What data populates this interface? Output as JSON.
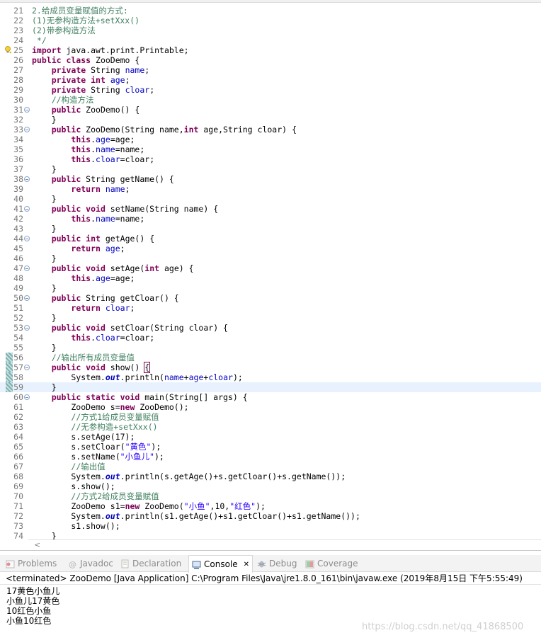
{
  "editor": {
    "lines": [
      {
        "n": "21",
        "html": "<span class=\"c\">2.给成员变量赋值的方式:</span>"
      },
      {
        "n": "22",
        "html": "<span class=\"c\">(1)无参构造方法+setXxx()</span>"
      },
      {
        "n": "23",
        "html": "<span class=\"c\">(2)带参构造方法</span>"
      },
      {
        "n": "24",
        "html": "<span class=\"c\"> */</span>"
      },
      {
        "n": "25",
        "html": "<span class=\"k\">import</span> java.awt.print.Printable;",
        "warn": true
      },
      {
        "n": "26",
        "html": "<span class=\"k\">public class</span> ZooDemo {"
      },
      {
        "n": "27",
        "html": "    <span class=\"k\">private</span> String <span class=\"f\">name</span>;"
      },
      {
        "n": "28",
        "html": "    <span class=\"k\">private int</span> <span class=\"f\">age</span>;"
      },
      {
        "n": "29",
        "html": "    <span class=\"k\">private</span> String <span class=\"f\">cloar</span>;"
      },
      {
        "n": "30",
        "html": "    <span class=\"c\">//构造方法</span>"
      },
      {
        "n": "31",
        "fold": true,
        "html": "    <span class=\"k\">public</span> ZooDemo() {"
      },
      {
        "n": "32",
        "html": "    }"
      },
      {
        "n": "33",
        "fold": true,
        "html": "    <span class=\"k\">public</span> ZooDemo(String name,<span class=\"k\">int</span> age,String cloar) {"
      },
      {
        "n": "34",
        "html": "        <span class=\"k\">this</span>.<span class=\"f\">age</span>=age;"
      },
      {
        "n": "35",
        "html": "        <span class=\"k\">this</span>.<span class=\"f\">name</span>=name;"
      },
      {
        "n": "36",
        "html": "        <span class=\"k\">this</span>.<span class=\"f\">cloar</span>=cloar;"
      },
      {
        "n": "37",
        "html": "    }"
      },
      {
        "n": "38",
        "fold": true,
        "html": "    <span class=\"k\">public</span> String getName() {"
      },
      {
        "n": "39",
        "html": "        <span class=\"k\">return</span> <span class=\"f\">name</span>;"
      },
      {
        "n": "40",
        "html": "    }"
      },
      {
        "n": "41",
        "fold": true,
        "html": "    <span class=\"k\">public void</span> setName(String name) {"
      },
      {
        "n": "42",
        "html": "        <span class=\"k\">this</span>.<span class=\"f\">name</span>=name;"
      },
      {
        "n": "43",
        "html": "    }"
      },
      {
        "n": "44",
        "fold": true,
        "html": "    <span class=\"k\">public int</span> getAge() {"
      },
      {
        "n": "45",
        "html": "        <span class=\"k\">return</span> <span class=\"f\">age</span>;"
      },
      {
        "n": "46",
        "html": "    }"
      },
      {
        "n": "47",
        "fold": true,
        "html": "    <span class=\"k\">public void</span> setAge(<span class=\"k\">int</span> age) {"
      },
      {
        "n": "48",
        "html": "        <span class=\"k\">this</span>.<span class=\"f\">age</span>=age;"
      },
      {
        "n": "49",
        "html": "    }"
      },
      {
        "n": "50",
        "fold": true,
        "html": "    <span class=\"k\">public</span> String getCloar() {"
      },
      {
        "n": "51",
        "html": "        <span class=\"k\">return</span> <span class=\"f\">cloar</span>;"
      },
      {
        "n": "52",
        "html": "    }"
      },
      {
        "n": "53",
        "fold": true,
        "html": "    <span class=\"k\">public void</span> setCloar(String cloar) {"
      },
      {
        "n": "54",
        "html": "        <span class=\"k\">this</span>.<span class=\"f\">cloar</span>=cloar;"
      },
      {
        "n": "55",
        "html": "    }"
      },
      {
        "n": "56",
        "chg": true,
        "html": "    <span class=\"c\">//输出所有成员变量值</span>"
      },
      {
        "n": "57",
        "chg": true,
        "fold": true,
        "html": "    <span class=\"k\">public void</span> show() <span class=\"box\">{</span>"
      },
      {
        "n": "58",
        "chg": true,
        "html": "        System.<span class=\"st\">out</span>.println(<span class=\"f\">name</span>+<span class=\"f\">age</span>+<span class=\"f\">cloar</span>);"
      },
      {
        "n": "59",
        "chg": true,
        "cur": true,
        "html": "    }"
      },
      {
        "n": "60",
        "fold": true,
        "html": "    <span class=\"k\">public static void</span> main(String[] args) {"
      },
      {
        "n": "61",
        "html": "        ZooDemo s=<span class=\"k\">new</span> ZooDemo();"
      },
      {
        "n": "62",
        "html": "        <span class=\"c\">//方式1给成员变量赋值</span>"
      },
      {
        "n": "63",
        "html": "        <span class=\"c\">//无参构造+setXxx()</span>"
      },
      {
        "n": "64",
        "html": "        s.setAge(17);"
      },
      {
        "n": "65",
        "html": "        s.setCloar(<span class=\"s\">\"黄色\"</span>);"
      },
      {
        "n": "66",
        "html": "        s.setName(<span class=\"s\">\"小鱼儿\"</span>);"
      },
      {
        "n": "67",
        "html": "        <span class=\"c\">//输出值</span>"
      },
      {
        "n": "68",
        "html": "        System.<span class=\"st\">out</span>.println(s.getAge()+s.getCloar()+s.getName());"
      },
      {
        "n": "69",
        "html": "        s.show();"
      },
      {
        "n": "70",
        "html": "        <span class=\"c\">//方式2给成员变量赋值</span>"
      },
      {
        "n": "71",
        "html": "        ZooDemo s1=<span class=\"k\">new</span> ZooDemo(<span class=\"s\">\"小鱼\"</span>,10,<span class=\"s\">\"红色\"</span>);"
      },
      {
        "n": "72",
        "html": "        System.<span class=\"st\">out</span>.println(s1.getAge()+s1.getCloar()+s1.getName());"
      },
      {
        "n": "73",
        "html": "        s1.show();"
      },
      {
        "n": "74",
        "html": "    }"
      }
    ]
  },
  "tabs": [
    {
      "label": "Problems",
      "icon": "problems-icon",
      "active": false
    },
    {
      "label": "Javadoc",
      "icon": "javadoc-icon",
      "active": false
    },
    {
      "label": "Declaration",
      "icon": "declaration-icon",
      "active": false
    },
    {
      "label": "Console",
      "icon": "console-icon",
      "active": true,
      "close": "✕"
    },
    {
      "label": "Debug",
      "icon": "debug-icon",
      "active": false
    },
    {
      "label": "Coverage",
      "icon": "coverage-icon",
      "active": false
    }
  ],
  "console": {
    "header": "<terminated> ZooDemo [Java Application] C:\\Program Files\\Java\\jre1.8.0_161\\bin\\javaw.exe (2019年8月15日 下午5:55:49)",
    "output": [
      "17黄色小鱼儿",
      "小鱼儿17黄色",
      "10红色小鱼",
      "小鱼10红色"
    ]
  },
  "watermark": "https://blog.csdn.net/qq_41868500",
  "colors": {
    "keyword": "#7f0055",
    "field": "#0000c0",
    "comment": "#3f7f5f",
    "string": "#2a00ff",
    "current_line": "#e8f2fe"
  }
}
